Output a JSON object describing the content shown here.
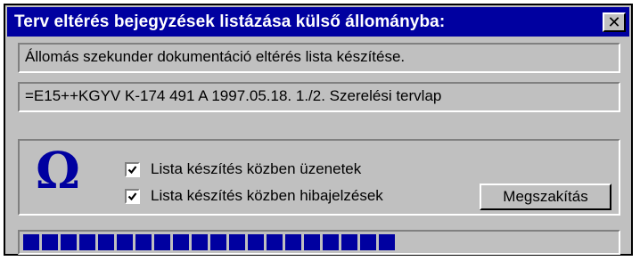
{
  "window": {
    "title": "Terv eltérés bejegyzések listázása külső állományba:",
    "close_symbol": "✕"
  },
  "lines": {
    "description": "Állomás szekunder dokumentáció eltérés lista készítése.",
    "document": "=E15++KGYV K-174 491 A 1997.05.18. 1./2. Szerelési tervlap"
  },
  "options": {
    "icon": "omega-icon",
    "messages_label": "Lista készítés közben üzenetek",
    "messages_checked": true,
    "errors_label": "Lista készítés közben hibajelzések",
    "errors_checked": true
  },
  "buttons": {
    "cancel_label": "Megszakítás"
  },
  "progress": {
    "fraction": 0.66
  },
  "colors": {
    "title_bg": "#0000a0",
    "progress": "#0000a0",
    "face": "#c0c0c0"
  }
}
